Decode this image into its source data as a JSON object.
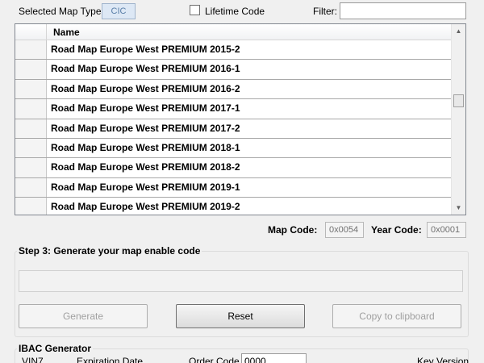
{
  "top": {
    "map_type_label": "Selected Map Type:",
    "map_type_value": "CIC",
    "lifetime_label": "Lifetime Code",
    "filter_label": "Filter:",
    "filter_value": ""
  },
  "grid": {
    "column_header": "Name",
    "rows": [
      "Road Map Europe West PREMIUM 2015-2",
      "Road Map Europe West PREMIUM 2016-1",
      "Road Map Europe West PREMIUM 2016-2",
      "Road Map Europe West PREMIUM 2017-1",
      "Road Map Europe West PREMIUM 2017-2",
      "Road Map Europe West PREMIUM 2018-1",
      "Road Map Europe West PREMIUM 2018-2",
      "Road Map Europe West PREMIUM 2019-1",
      "Road Map Europe West PREMIUM 2019-2"
    ]
  },
  "codes": {
    "map_code_label": "Map Code:",
    "map_code_value": "0x0054",
    "year_code_label": "Year Code:",
    "year_code_value": "0x0001"
  },
  "step3": {
    "title": "Step 3: Generate your map enable code",
    "generate_label": "Generate",
    "reset_label": "Reset",
    "copy_label": "Copy to clipboard"
  },
  "ibac": {
    "title": "IBAC Generator",
    "vin_label": "VIN7",
    "expiration_label": "Expiration Date",
    "order_code_label": "Order Code",
    "order_code_value": "0000",
    "key_version_label": "Key Version"
  }
}
